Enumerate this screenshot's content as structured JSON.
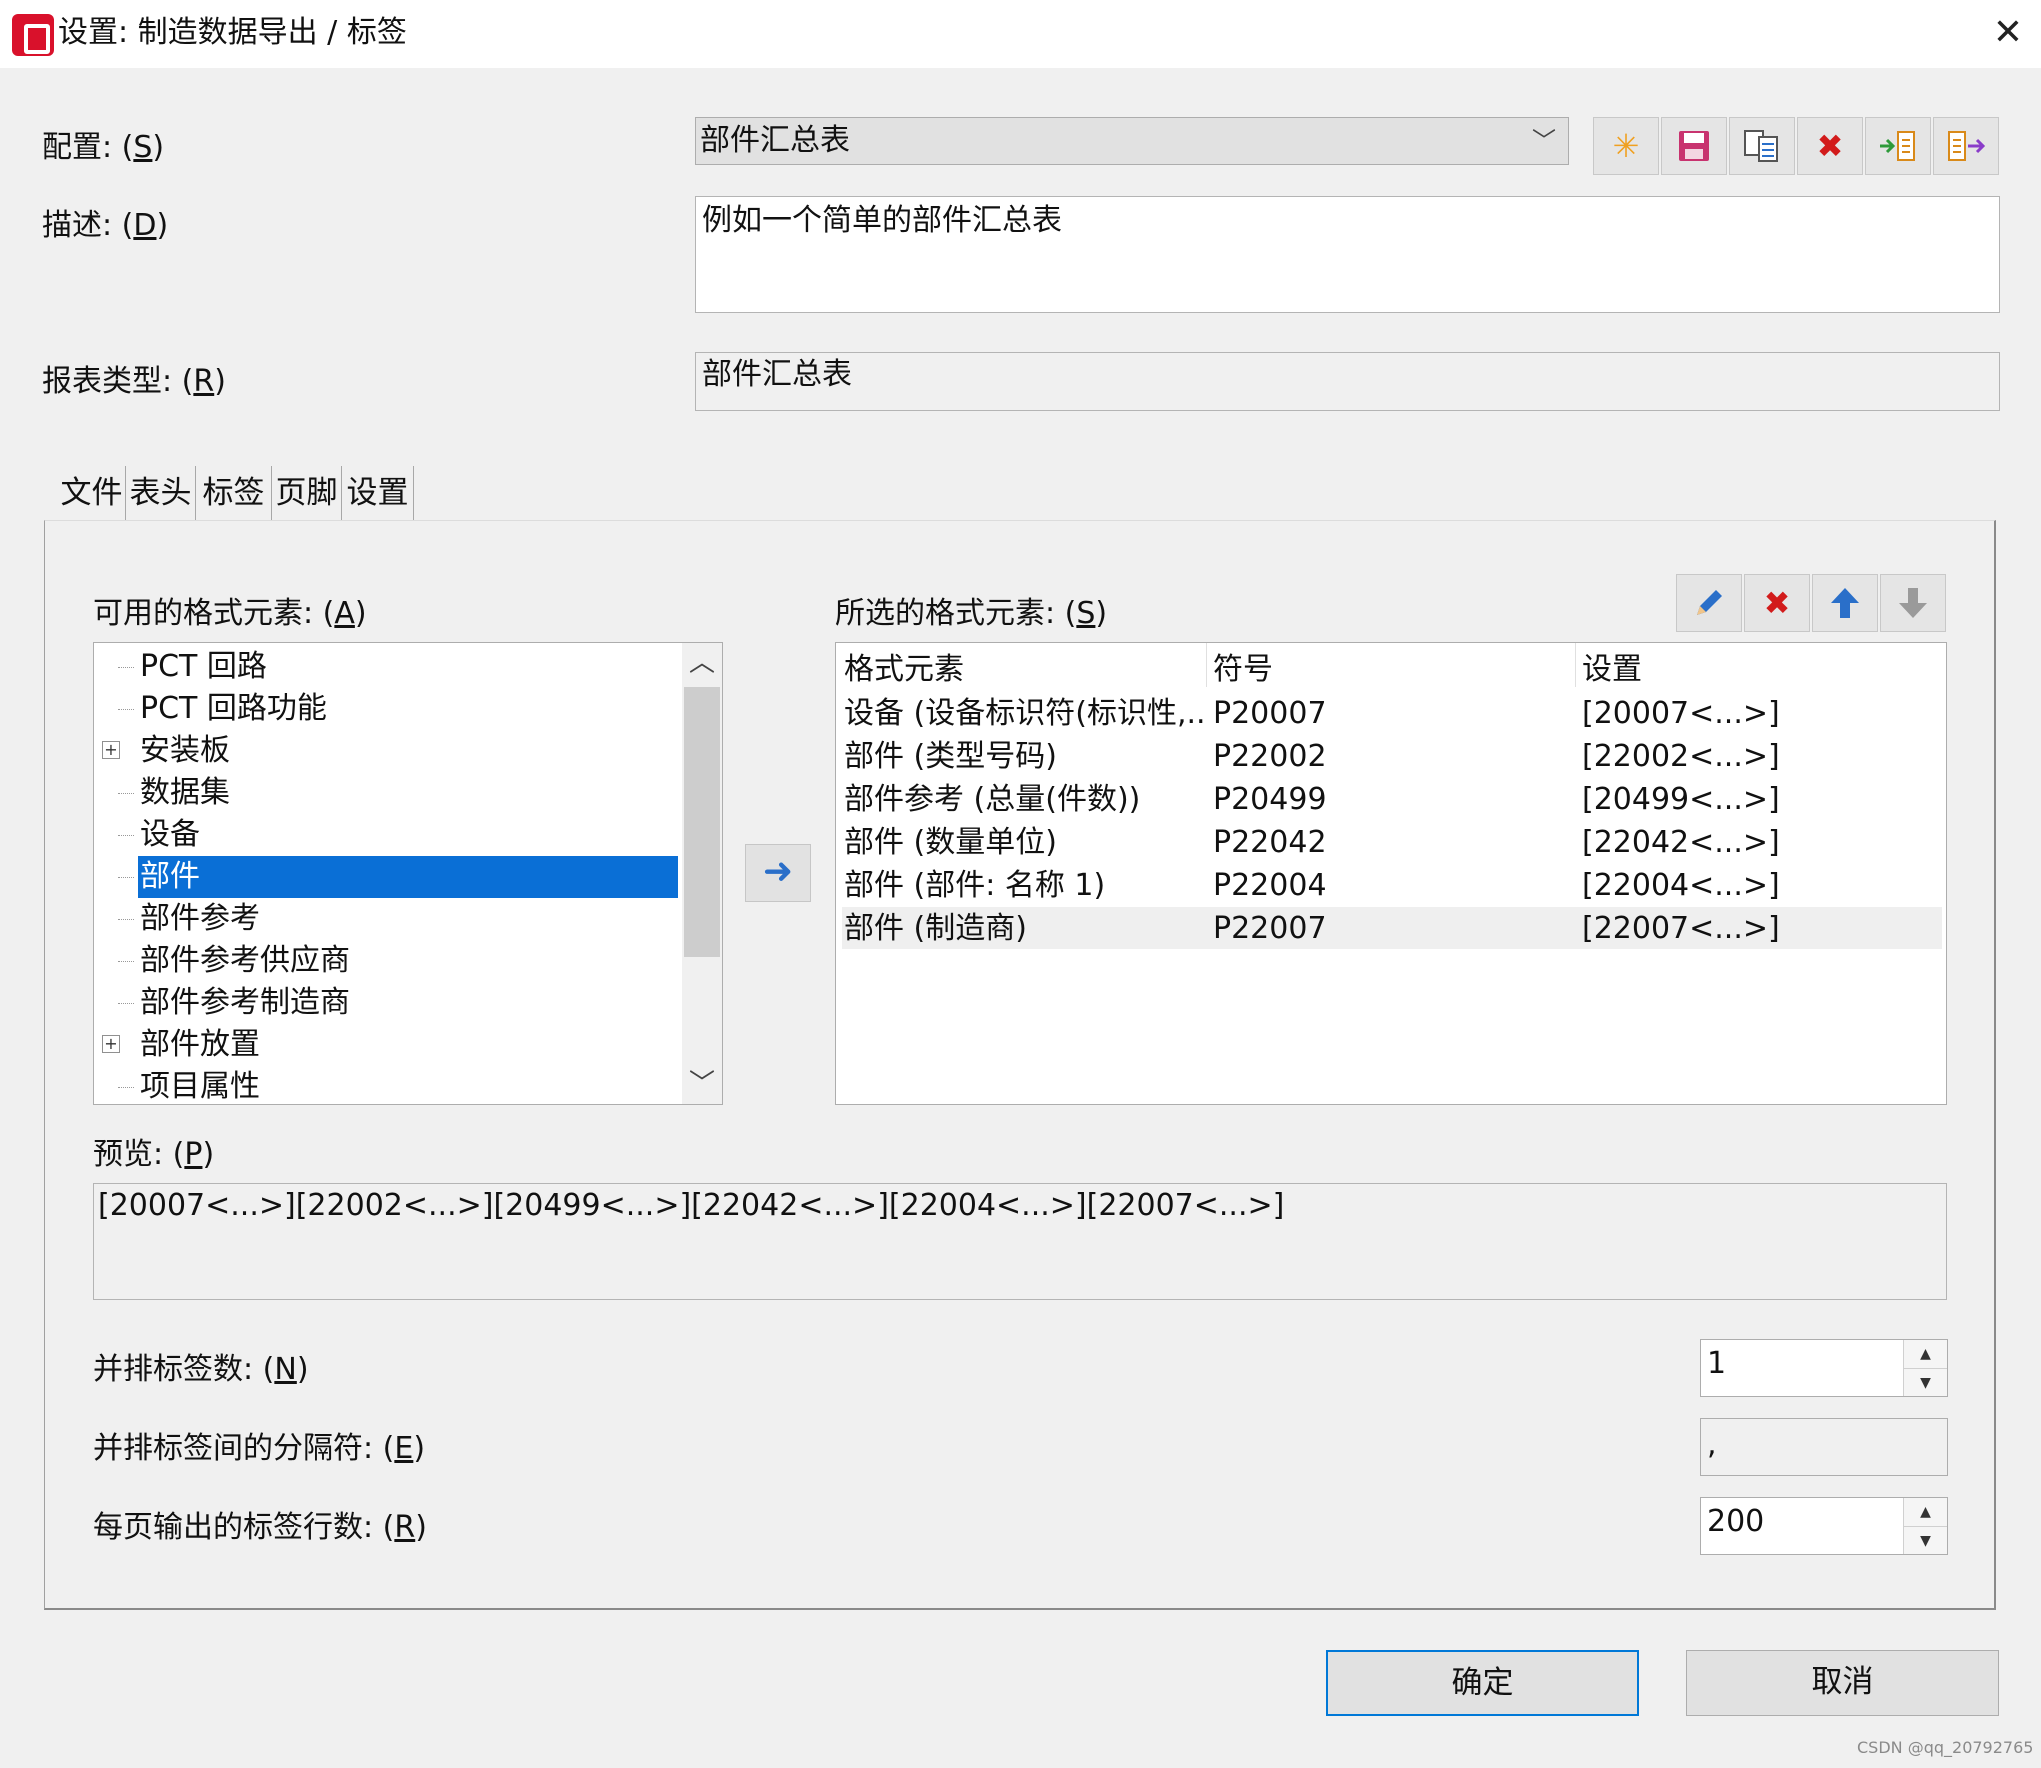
{
  "window": {
    "title": "设置: 制造数据导出 / 标签",
    "icon": "eplan-app-icon",
    "close_glyph": "✕"
  },
  "config": {
    "label_prefix": "配置: (",
    "label_key": "S",
    "label_suffix": ")",
    "value": "部件汇总表"
  },
  "description": {
    "label_prefix": "描述: (",
    "label_key": "D",
    "label_suffix": ")",
    "value": "例如一个简单的部件汇总表"
  },
  "report_type": {
    "label_prefix": "报表类型: (",
    "label_key": "R",
    "label_suffix": ")",
    "value": "部件汇总表"
  },
  "toolbar_icons": [
    "new-icon",
    "save-icon",
    "copy-icon",
    "delete-icon",
    "import-icon",
    "export-icon"
  ],
  "tabs": [
    {
      "label": "文件"
    },
    {
      "label": "表头"
    },
    {
      "label": "标签",
      "active": true
    },
    {
      "label": "页脚"
    },
    {
      "label": "设置"
    }
  ],
  "available": {
    "label_prefix": "可用的格式元素: (",
    "label_key": "A",
    "label_suffix": ")",
    "items": [
      {
        "label": "PCT 回路",
        "expandable": false
      },
      {
        "label": "PCT 回路功能",
        "expandable": false
      },
      {
        "label": "安装板",
        "expandable": true
      },
      {
        "label": "数据集",
        "expandable": false
      },
      {
        "label": "设备",
        "expandable": false
      },
      {
        "label": "部件",
        "expandable": false,
        "selected": true
      },
      {
        "label": "部件参考",
        "expandable": false
      },
      {
        "label": "部件参考供应商",
        "expandable": false
      },
      {
        "label": "部件参考制造商",
        "expandable": false
      },
      {
        "label": "部件放置",
        "expandable": true
      },
      {
        "label": "项目属性",
        "expandable": false
      }
    ]
  },
  "selected": {
    "label_prefix": "所选的格式元素: (",
    "label_key": "S",
    "label_suffix": ")",
    "columns": [
      "格式元素",
      "符号",
      "设置"
    ],
    "rows": [
      [
        "设备 (设备标识符(标识性,...",
        "P20007",
        "[20007<...>]"
      ],
      [
        "部件 (类型号码)",
        "P22002",
        "[22002<...>]"
      ],
      [
        "部件参考 (总量(件数))",
        "P20499",
        "[20499<...>]"
      ],
      [
        "部件 (数量单位)",
        "P22042",
        "[22042<...>]"
      ],
      [
        "部件 (部件: 名称 1)",
        "P22004",
        "[22004<...>]"
      ],
      [
        "部件 (制造商)",
        "P22007",
        "[22007<...>]"
      ]
    ],
    "highlighted_row": 5
  },
  "preview": {
    "label_prefix": "预览: (",
    "label_key": "P",
    "label_suffix": ")",
    "value": "[20007<...>][22002<...>][20499<...>][22042<...>][22004<...>][22007<...>]"
  },
  "labels_side_by_side": {
    "label_prefix": "并排标签数: (",
    "label_key": "N",
    "label_suffix": ")",
    "value": "1"
  },
  "separator": {
    "label_prefix": "并排标签间的分隔符: (",
    "label_key": "E",
    "label_suffix": ")",
    "value": ","
  },
  "rows_per_page": {
    "label_prefix": "每页输出的标签行数: (",
    "label_key": "R",
    "label_suffix": ")",
    "value": "200"
  },
  "buttons": {
    "ok": "确定",
    "cancel": "取消"
  },
  "watermark": "CSDN @qq_20792765"
}
